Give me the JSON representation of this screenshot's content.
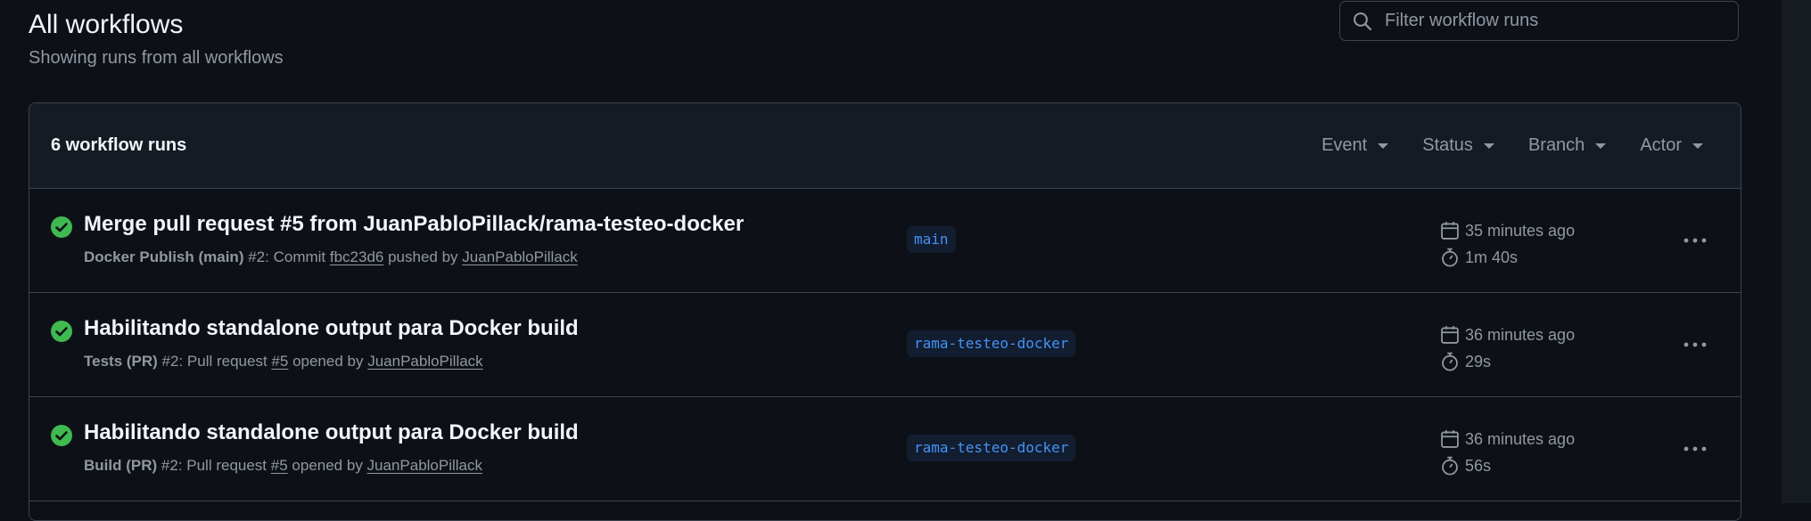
{
  "header": {
    "title": "All workflows",
    "subtitle": "Showing runs from all workflows"
  },
  "search": {
    "placeholder": "Filter workflow runs",
    "icon": "search-icon"
  },
  "panel": {
    "count_label": "6 workflow runs",
    "filters": [
      "Event",
      "Status",
      "Branch",
      "Actor"
    ]
  },
  "runs": [
    {
      "title": "Merge pull request #5 from JuanPabloPillack/rama-testeo-docker",
      "workflow": "Docker Publish (main)",
      "run_number": "#2",
      "event_text": ": Commit ",
      "ref": "fbc23d6",
      "action_text": " pushed by ",
      "actor": "JuanPabloPillack",
      "branch": "main",
      "time_ago": "35 minutes ago",
      "duration": "1m 40s",
      "status": "success"
    },
    {
      "title": "Habilitando standalone output para Docker build",
      "workflow": "Tests (PR)",
      "run_number": "#2",
      "event_text": ": Pull request ",
      "ref": "#5",
      "action_text": " opened by ",
      "actor": "JuanPabloPillack",
      "branch": "rama-testeo-docker",
      "time_ago": "36 minutes ago",
      "duration": "29s",
      "status": "success"
    },
    {
      "title": "Habilitando standalone output para Docker build",
      "workflow": "Build (PR)",
      "run_number": "#2",
      "event_text": ": Pull request ",
      "ref": "#5",
      "action_text": " opened by ",
      "actor": "JuanPabloPillack",
      "branch": "rama-testeo-docker",
      "time_ago": "36 minutes ago",
      "duration": "56s",
      "status": "success"
    }
  ],
  "colors": {
    "background": "#0d1117",
    "panel_header": "#151b23",
    "border": "#3d444d",
    "success": "#3fb950",
    "branch_text": "#4493f8",
    "muted_text": "#9198a1"
  }
}
